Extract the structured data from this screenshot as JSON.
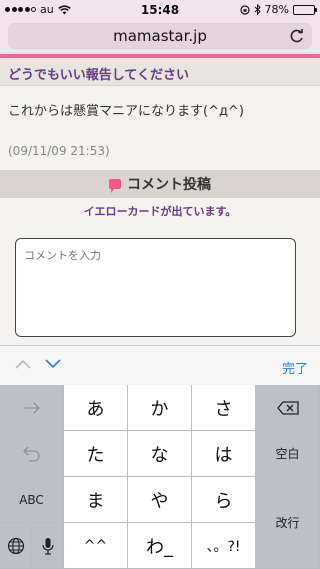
{
  "status_bar": {
    "carrier": "au",
    "time": "15:48",
    "battery_percent": "78%",
    "battery_level": 0.78
  },
  "browser": {
    "url": "mamastar.jp"
  },
  "page": {
    "section_title": "どうでもいい報告してください",
    "post_text": "これからは懸賞マニアになります(^д^)",
    "post_date": "(09/11/09 21:53)",
    "comment_title": "コメント投稿",
    "notice": "イエローカードが出ています。",
    "comment_placeholder": "コメントを入力"
  },
  "accessory": {
    "done_label": "完了"
  },
  "keyboard": {
    "row1": [
      "あ",
      "か",
      "さ"
    ],
    "row2": [
      "た",
      "な",
      "は"
    ],
    "row3": [
      "ま",
      "や",
      "ら"
    ],
    "row4": [
      "^^",
      "わ_",
      "、。?!"
    ],
    "space_label": "空白",
    "abc_label": "ABC",
    "return_label": "改行"
  },
  "colors": {
    "accent_pink": "#f06592",
    "heading_purple": "#6a3a8a",
    "link_blue": "#2a7fd6"
  }
}
